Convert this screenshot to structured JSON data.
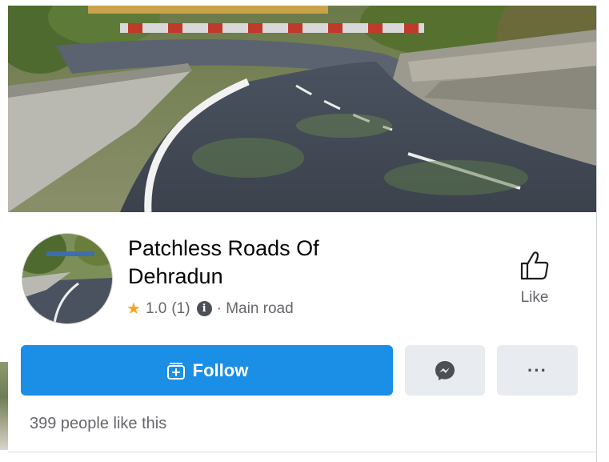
{
  "page": {
    "title": "Patchless Roads Of Dehradun",
    "rating_value": "1.0",
    "rating_count": "(1)",
    "category": "· Main road",
    "likes_text": "399 people like this"
  },
  "actions": {
    "like_label": "Like",
    "follow_label": "Follow",
    "more_label": "···"
  },
  "icons": {
    "star": "star-icon",
    "info": "info-icon",
    "like": "thumbs-up-icon",
    "follow": "follow-icon",
    "messenger": "messenger-icon",
    "more": "more-icon"
  },
  "colors": {
    "follow_button": "#1b8ee6",
    "secondary_button": "#e8ebef",
    "star": "#f5a623",
    "secondary_text": "#65676b"
  }
}
